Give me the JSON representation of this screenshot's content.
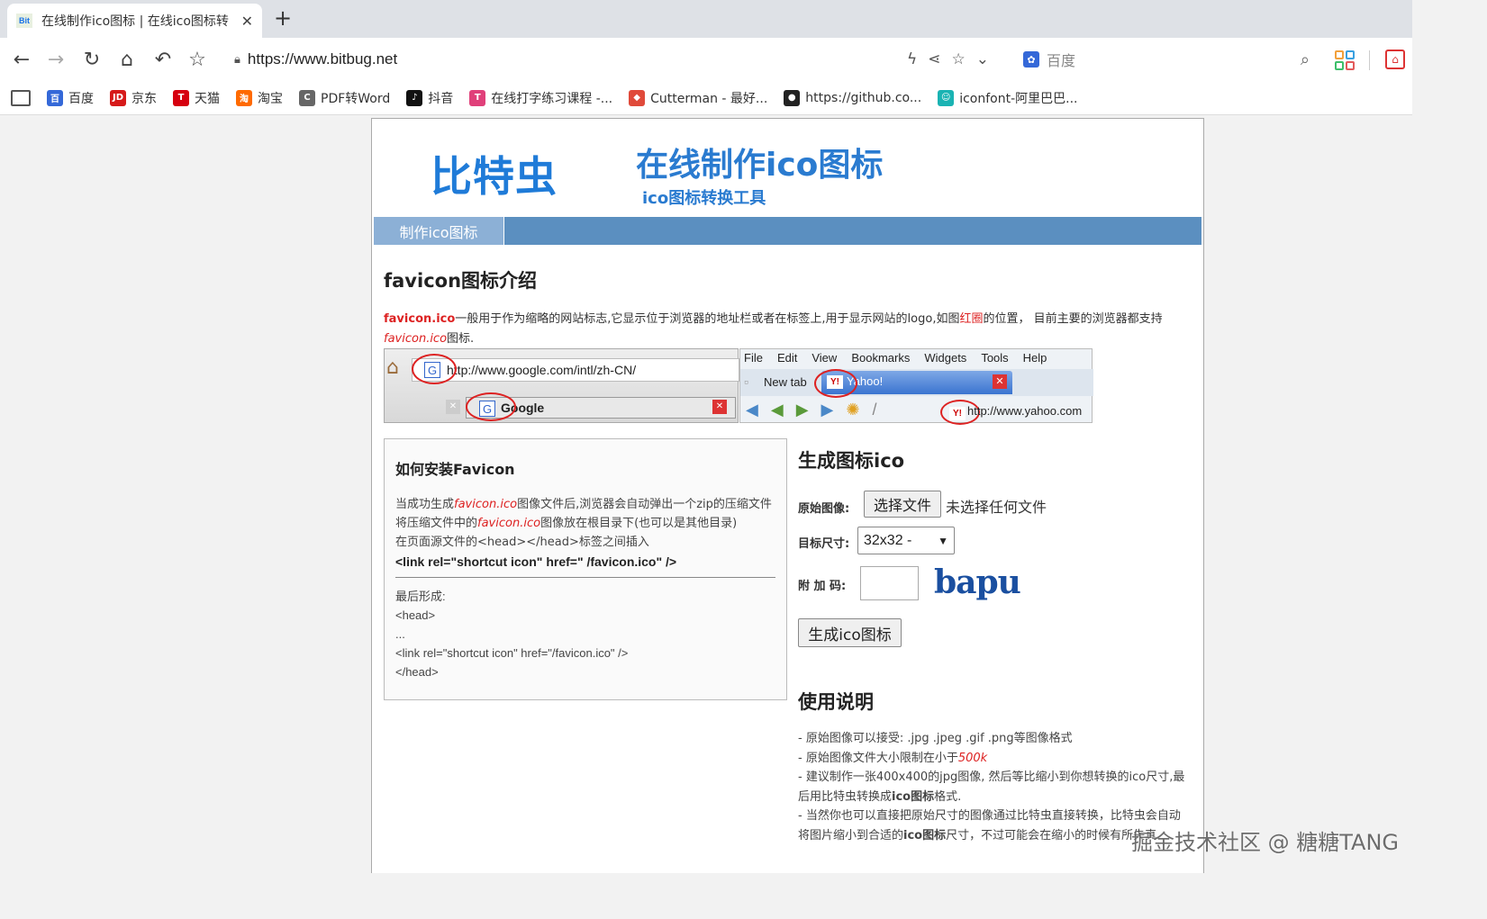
{
  "browser": {
    "tab_title": "在线制作ico图标 | 在线ico图标转",
    "tab_close": "✕",
    "new_tab": "+",
    "url": "https://www.bitbug.net",
    "search_placeholder": "百度"
  },
  "bookmarks": [
    {
      "label": "百度",
      "icon": "baidu-icon",
      "color": "#3468d8",
      "glyph": "百"
    },
    {
      "label": "京东",
      "icon": "jd-icon",
      "color": "#d61a1a",
      "glyph": "JD"
    },
    {
      "label": "天猫",
      "icon": "tmall-icon",
      "color": "#d6000f",
      "glyph": "T"
    },
    {
      "label": "淘宝",
      "icon": "taobao-icon",
      "color": "#ff6a00",
      "glyph": "淘"
    },
    {
      "label": "PDF转Word",
      "icon": "pdf-icon",
      "color": "#666666",
      "glyph": "C"
    },
    {
      "label": "抖音",
      "icon": "douyin-icon",
      "color": "#111111",
      "glyph": "♪"
    },
    {
      "label": "在线打字练习课程 -...",
      "icon": "typing-icon",
      "color": "#e0407a",
      "glyph": "T"
    },
    {
      "label": "Cutterman - 最好...",
      "icon": "cutterman-icon",
      "color": "#e04a3a",
      "glyph": "◆"
    },
    {
      "label": "https://github.co...",
      "icon": "github-icon",
      "color": "#222222",
      "glyph": "●"
    },
    {
      "label": "iconfont-阿里巴巴...",
      "icon": "iconfont-icon",
      "color": "#1ab3b3",
      "glyph": "☺"
    }
  ],
  "page": {
    "logo": "比特虫",
    "title": "在线制作ico图标",
    "subtitle": "ico图标转换工具",
    "menu_item": "制作ico图标",
    "intro_heading": "favicon图标介绍",
    "intro_p1_a": "favicon.ico",
    "intro_p1_b": "一般用于作为缩略的网站标志,它显示位于浏览器的地址栏或者在标签上,用于显示网站的logo,如图",
    "intro_p1_c": "红圈",
    "intro_p1_d": "的位置，  目前主要的浏览器都支持",
    "intro_p1_e": "favicon.ico",
    "intro_p1_f": "图标.",
    "demo": {
      "google_url": "http://www.google.com/intl/zh-CN/",
      "google_tab": "Google",
      "menu": [
        "File",
        "Edit",
        "View",
        "Bookmarks",
        "Widgets",
        "Tools",
        "Help"
      ],
      "new_tab": "New tab",
      "yahoo_tab": "Yahoo!",
      "yahoo_url": "http://www.yahoo.com"
    },
    "install": {
      "heading": "如何安装Favicon",
      "line1_a": "当成功生成",
      "line1_b": "favicon.ico",
      "line1_c": "图像文件后,浏览器会自动弹出一个zip的压缩文件",
      "line2_a": "将压缩文件中的",
      "line2_b": "favicon.ico",
      "line2_c": "图像放在根目录下(也可以是其他目录)",
      "line3": "在页面源文件的<head></head>标签之间插入",
      "code": "<link rel=\"shortcut icon\" href=\" /favicon.ico\" />",
      "final_label": "最后形成:",
      "final_1": "<head>",
      "final_2": "...",
      "final_3": "<link rel=\"shortcut icon\" href=\"/favicon.ico\" />",
      "final_4": "</head>"
    },
    "generate": {
      "heading": "生成图标ico",
      "source_label": "原始图像:",
      "file_button": "选择文件",
      "file_status": "未选择任何文件",
      "size_label": "目标尺寸:",
      "size_value": "32x32 -",
      "captcha_label": "附 加 码:",
      "captcha_text": "bapu",
      "submit": "生成ico图标"
    },
    "usage": {
      "heading": "使用说明",
      "l1": "- 原始图像可以接受: .jpg .jpeg .gif .png等图像格式",
      "l2_a": "- 原始图像文件大小限制在小于",
      "l2_b": "500k",
      "l3": "- 建议制作一张400x400的jpg图像, 然后等比缩小到你想转换的ico尺寸,最后用比特虫转换成",
      "l3_b": "ico图标",
      "l3_c": "格式.",
      "l4": "- 当然你也可以直接把原始尺寸的图像通过比特虫直接转换，比特虫会自动将图片缩小到合适的",
      "l4_b": "ico图标",
      "l4_c": "尺寸，不过可能会在缩小的时候有所失真"
    }
  },
  "watermark": "掘金技术社区 @ 糖糖TANG"
}
